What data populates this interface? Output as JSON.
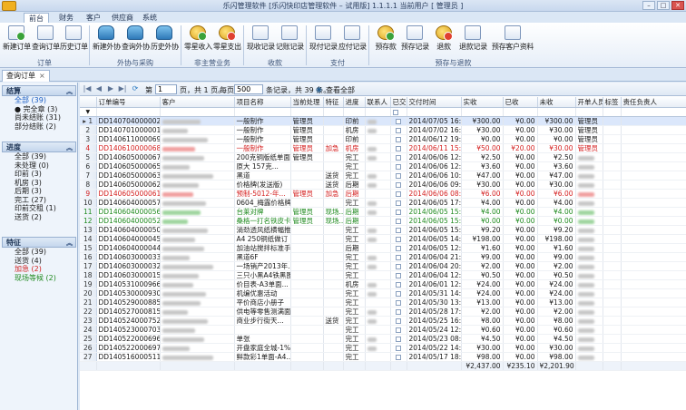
{
  "window": {
    "title": "乐闪管理软件 [乐闪快印店管理软件 – 试用版] 1.1.1.1 当前用户 [ 管理员 ]",
    "controls": [
      "–",
      "□",
      "✕"
    ]
  },
  "menu_tabs": [
    {
      "label": "前台",
      "active": true
    },
    {
      "label": "财务"
    },
    {
      "label": "客户"
    },
    {
      "label": "供应商"
    },
    {
      "label": "系统"
    }
  ],
  "ribbon": {
    "buttons": [
      {
        "label": "新建订单",
        "icon": "doc"
      },
      {
        "label": "查询订单",
        "icon": "doc"
      },
      {
        "label": "历史订单",
        "icon": "doc"
      },
      {
        "label": "新建外协",
        "icon": "db"
      },
      {
        "label": "查询外协",
        "icon": "db"
      },
      {
        "label": "历史外协",
        "icon": "db"
      },
      {
        "label": "零星收入",
        "icon": "coin"
      },
      {
        "label": "零星支出",
        "icon": "coin"
      },
      {
        "label": "现收记录",
        "icon": "doc"
      },
      {
        "label": "记账记录",
        "icon": "doc"
      },
      {
        "label": "现付记录",
        "icon": "doc"
      },
      {
        "label": "应付记录",
        "icon": "doc"
      },
      {
        "label": "预存款",
        "icon": "coin"
      },
      {
        "label": "预存记录",
        "icon": "doc"
      },
      {
        "label": "退款",
        "icon": "coin"
      },
      {
        "label": "退款记录",
        "icon": "doc"
      },
      {
        "label": "预存客户资料",
        "icon": "doc"
      }
    ],
    "groups": [
      "订单",
      "外协与采购",
      "非主营业务",
      "收款",
      "支付",
      "预存与退款"
    ]
  },
  "doc_tab": {
    "label": "查询订单",
    "close": "×"
  },
  "left": {
    "sections": [
      {
        "title": "结算",
        "items": [
          {
            "label": "全部 (39)",
            "style": "sel"
          },
          {
            "label": "● 完全章 (3)"
          },
          {
            "label": "尚未结账 (31)"
          },
          {
            "label": "部分结账 (2)"
          }
        ]
      },
      {
        "title": "进度",
        "items": [
          {
            "label": "全部 (39)"
          },
          {
            "label": "未处理 (0)"
          },
          {
            "label": "印前 (3)"
          },
          {
            "label": "机房 (3)"
          },
          {
            "label": "后期 (3)"
          },
          {
            "label": "完工 (27)"
          },
          {
            "label": "印前交租 (1)"
          },
          {
            "label": "送货 (2)"
          }
        ]
      },
      {
        "title": "特征",
        "items": [
          {
            "label": "全部 (39)"
          },
          {
            "label": "送货 (4)"
          },
          {
            "label": "加急 (2)",
            "style": "red"
          },
          {
            "label": "现场等候 (2)",
            "style": "grn"
          }
        ]
      }
    ]
  },
  "pager": {
    "first": "|◀",
    "prev": "◀",
    "next": "▶",
    "last": "▶|",
    "refresh": "⟳",
    "page_prefix": "第",
    "page_value": "1",
    "page_suffix": "页，共 1 页。",
    "per_page_label": "每页",
    "per_page_value": "500",
    "summary": "条记录，共 39 条。",
    "view_all": "查看全部"
  },
  "columns": [
    "",
    "订单编号",
    "客户",
    "项目名称",
    "当前处理",
    "特征",
    "进度",
    "联系人",
    "已交付",
    "交付时间",
    "实收",
    "已收",
    "未收",
    "开单人员",
    "标签",
    "责任负责人"
  ],
  "rows": [
    {
      "n": "1",
      "id": "DD140704000002",
      "cust": "",
      "item": "一般制作",
      "cur": "管理员",
      "feat": "",
      "prog": "印前",
      "contact": "",
      "time": "2014/07/05 16:56",
      "paid": "¥300.00",
      "recv": "¥0.00",
      "due": "¥300.00",
      "op": "管理员",
      "style": "sel"
    },
    {
      "n": "2",
      "id": "DD140701000001",
      "cust": "",
      "item": "一般制作",
      "cur": "管理员",
      "feat": "",
      "prog": "机房",
      "contact": "",
      "time": "2014/07/02 16:53",
      "paid": "¥30.00",
      "recv": "¥0.00",
      "due": "¥30.00",
      "op": "管理员"
    },
    {
      "n": "3",
      "id": "DD140611000069",
      "cust": "",
      "item": "一般制作",
      "cur": "管理员",
      "feat": "",
      "prog": "印前",
      "contact": "",
      "time": "2014/06/12 19:48",
      "paid": "¥0.00",
      "recv": "¥0.00",
      "due": "¥0.00",
      "op": "管理员"
    },
    {
      "n": "4",
      "id": "DD140610000068",
      "cust": "",
      "item": "一般制作",
      "cur": "管理员",
      "feat": "加急",
      "prog": "机房",
      "contact": "",
      "time": "2014/06/11 15:36",
      "paid": "¥50.00",
      "recv": "¥20.00",
      "due": "¥30.00",
      "op": "管理员",
      "style": "red"
    },
    {
      "n": "5",
      "id": "DD140605000067",
      "cust": "",
      "item": "200克铜版纸单面",
      "cur": "管理员",
      "feat": "",
      "prog": "完工",
      "contact": "",
      "time": "2014/06/06 12:58",
      "paid": "¥2.50",
      "recv": "¥0.00",
      "due": "¥2.50",
      "op": ""
    },
    {
      "n": "6",
      "id": "DD140605000065",
      "cust": "",
      "item": "原大 157克...",
      "cur": "",
      "feat": "",
      "prog": "完工",
      "contact": "",
      "time": "2014/06/06 12:58",
      "paid": "¥3.60",
      "recv": "¥0.00",
      "due": "¥3.60",
      "op": ""
    },
    {
      "n": "7",
      "id": "DD140605000063",
      "cust": "",
      "item": "黑道",
      "cur": "",
      "feat": "送货",
      "prog": "完工",
      "contact": "",
      "time": "2014/06/06 10:02",
      "paid": "¥47.00",
      "recv": "¥0.00",
      "due": "¥47.00",
      "op": ""
    },
    {
      "n": "8",
      "id": "DD140605000062",
      "cust": "",
      "item": "价格牌(发送版)",
      "cur": "",
      "feat": "送货",
      "prog": "后期",
      "contact": "",
      "time": "2014/06/06 09:46",
      "paid": "¥30.00",
      "recv": "¥0.00",
      "due": "¥30.00",
      "op": ""
    },
    {
      "n": "9",
      "id": "DD140605000061",
      "cust": "",
      "item": "预制-5012-年...",
      "cur": "管理员",
      "feat": "加急",
      "prog": "后期",
      "contact": "",
      "time": "2014/06/06 08:26",
      "paid": "¥6.00",
      "recv": "¥0.00",
      "due": "¥6.00",
      "op": "",
      "style": "red"
    },
    {
      "n": "10",
      "id": "DD140604000057",
      "cust": "",
      "item": "0604_梅露价格牌",
      "cur": "",
      "feat": "",
      "prog": "完工",
      "contact": "",
      "time": "2014/06/05 17:29",
      "paid": "¥4.00",
      "recv": "¥0.00",
      "due": "¥4.00",
      "op": ""
    },
    {
      "n": "11",
      "id": "DD140604000056",
      "cust": "",
      "item": "台莱对牌",
      "cur": "管理员",
      "feat": "现场...",
      "prog": "后期",
      "contact": "",
      "time": "2014/06/05 15:51",
      "paid": "¥4.00",
      "recv": "¥0.00",
      "due": "¥4.00",
      "op": "",
      "style": "grn"
    },
    {
      "n": "12",
      "id": "DD140604000052",
      "cust": "",
      "item": "桑格一打名铁皮卡...",
      "cur": "管理员",
      "feat": "现场...",
      "prog": "后期",
      "contact": "",
      "time": "2014/06/05 15:26",
      "paid": "¥0.00",
      "recv": "¥0.00",
      "due": "¥0.00",
      "op": "",
      "style": "grn"
    },
    {
      "n": "13",
      "id": "DD140604000050",
      "cust": "",
      "item": "淌劲透风纸横幅推柜...",
      "cur": "",
      "feat": "",
      "prog": "完工",
      "contact": "",
      "time": "2014/06/05 15:08",
      "paid": "¥9.20",
      "recv": "¥0.00",
      "due": "¥9.20",
      "op": ""
    },
    {
      "n": "14",
      "id": "DD140604000045",
      "cust": "",
      "item": "A4 250铜纸做订",
      "cur": "",
      "feat": "",
      "prog": "完工",
      "contact": "",
      "time": "2014/06/05 14:50",
      "paid": "¥198.00",
      "recv": "¥0.00",
      "due": "¥198.00",
      "op": ""
    },
    {
      "n": "15",
      "id": "DD140604000044",
      "cust": "",
      "item": "加油站搅拌标准手...",
      "cur": "",
      "feat": "",
      "prog": "后期",
      "contact": "",
      "time": "2014/06/05 12:49",
      "paid": "¥1.60",
      "recv": "¥0.00",
      "due": "¥1.60",
      "op": ""
    },
    {
      "n": "16",
      "id": "DD140603000033",
      "cust": "",
      "item": "黑道6F",
      "cur": "",
      "feat": "",
      "prog": "完工",
      "contact": "",
      "time": "2014/06/04 21:36",
      "paid": "¥9.00",
      "recv": "¥0.00",
      "due": "¥9.00",
      "op": ""
    },
    {
      "n": "17",
      "id": "DD140603000032",
      "cust": "",
      "item": "一场销产2013年...",
      "cur": "",
      "feat": "",
      "prog": "完工",
      "contact": "",
      "time": "2014/06/04 20:16",
      "paid": "¥2.00",
      "recv": "¥0.00",
      "due": "¥2.00",
      "op": ""
    },
    {
      "n": "18",
      "id": "DD140603000015",
      "cust": "",
      "item": "三只小黑A4铁黑图",
      "cur": "",
      "feat": "",
      "prog": "完工",
      "contact": "",
      "time": "2014/06/04 12:40",
      "paid": "¥0.50",
      "recv": "¥0.00",
      "due": "¥0.50",
      "op": ""
    },
    {
      "n": "19",
      "id": "DD140531000966",
      "cust": "",
      "item": "价目表-A3单面...",
      "cur": "",
      "feat": "",
      "prog": "机房",
      "contact": "",
      "time": "2014/06/01 12:05",
      "paid": "¥24.00",
      "recv": "¥0.00",
      "due": "¥24.00",
      "op": ""
    },
    {
      "n": "20",
      "id": "DD140530000930",
      "cust": "",
      "item": "机编优惠活动",
      "cur": "",
      "feat": "",
      "prog": "完工",
      "contact": "",
      "time": "2014/05/31 14:59",
      "paid": "¥24.00",
      "recv": "¥0.00",
      "due": "¥24.00",
      "op": ""
    },
    {
      "n": "21",
      "id": "DD140529000885",
      "cust": "",
      "item": "平价商店小册子",
      "cur": "",
      "feat": "",
      "prog": "完工",
      "contact": "",
      "time": "2014/05/30 13:30",
      "paid": "¥13.00",
      "recv": "¥0.00",
      "due": "¥13.00",
      "op": ""
    },
    {
      "n": "22",
      "id": "DD140527000815",
      "cust": "",
      "item": "供电等零售测满面...",
      "cur": "",
      "feat": "",
      "prog": "完工",
      "contact": "",
      "time": "2014/05/28 17:14",
      "paid": "¥2.00",
      "recv": "¥0.00",
      "due": "¥2.00",
      "op": ""
    },
    {
      "n": "23",
      "id": "DD140524000752",
      "cust": "",
      "item": "商业步行街天...",
      "cur": "",
      "feat": "送货",
      "prog": "完工",
      "contact": "",
      "time": "2014/05/25 16:46",
      "paid": "¥8.00",
      "recv": "¥0.00",
      "due": "¥8.00",
      "op": ""
    },
    {
      "n": "24",
      "id": "DD140523000703",
      "cust": "",
      "item": "",
      "cur": "",
      "feat": "",
      "prog": "完工",
      "contact": "",
      "time": "2014/05/24 12:56",
      "paid": "¥0.60",
      "recv": "¥0.00",
      "due": "¥0.60",
      "op": ""
    },
    {
      "n": "25",
      "id": "DD140522000696",
      "cust": "",
      "item": "单张",
      "cur": "",
      "feat": "",
      "prog": "完工",
      "contact": "",
      "time": "2014/05/23 08:39",
      "paid": "¥4.50",
      "recv": "¥0.00",
      "due": "¥4.50",
      "op": ""
    },
    {
      "n": "26",
      "id": "DD140522000697",
      "cust": "",
      "item": "开盘家庭全城-1%28...",
      "cur": "",
      "feat": "",
      "prog": "完工",
      "contact": "",
      "time": "2014/05/22 14:44",
      "paid": "¥30.00",
      "recv": "¥0.00",
      "due": "¥30.00",
      "op": ""
    },
    {
      "n": "27",
      "id": "DD140516000511",
      "cust": "",
      "item": "鲜款彩1单面-A4..",
      "cur": "",
      "feat": "",
      "prog": "完工",
      "contact": "",
      "time": "2014/05/17 18:27",
      "paid": "¥98.00",
      "recv": "¥0.00",
      "due": "¥98.00",
      "op": ""
    }
  ],
  "totals": {
    "paid": "¥2,437.00",
    "recv": "¥235.10",
    "due": "¥2,201.90"
  }
}
